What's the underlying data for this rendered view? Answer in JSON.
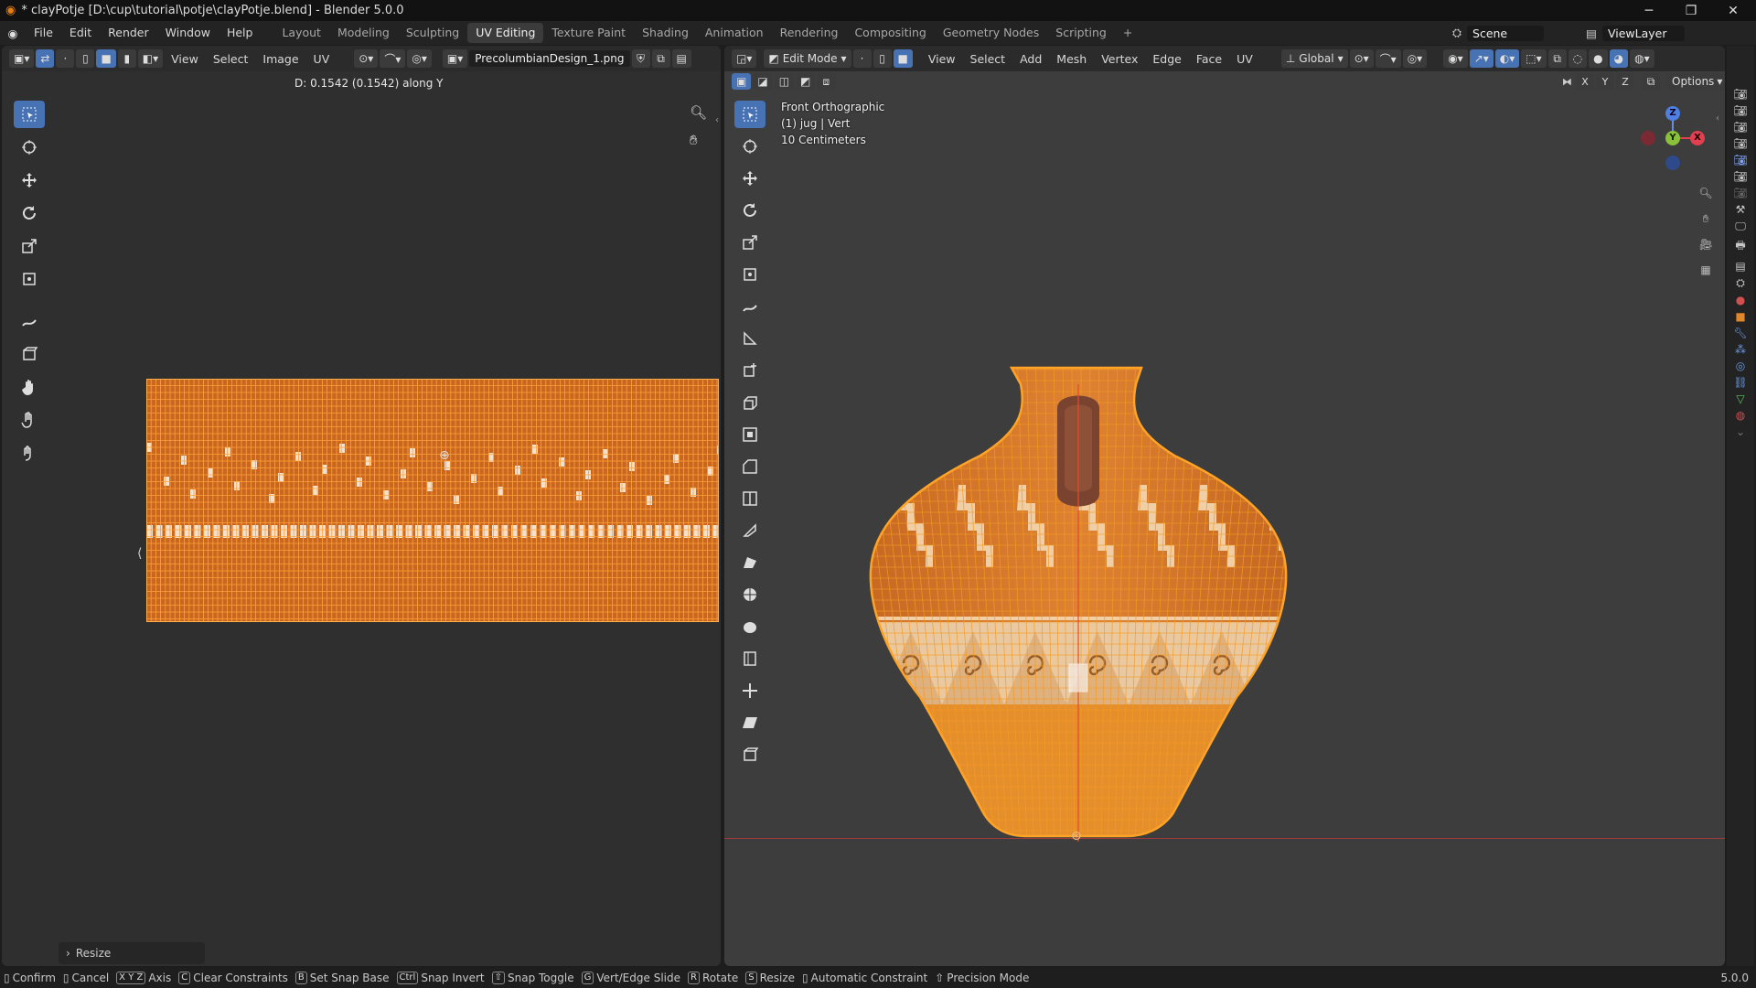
{
  "window": {
    "title": "* clayPotje [D:\\cup\\tutorial\\potje\\clayPotje.blend] - Blender 5.0.0",
    "minimize": "─",
    "restore": "❐",
    "close": "✕"
  },
  "menu": {
    "items": [
      "File",
      "Edit",
      "Render",
      "Window",
      "Help"
    ]
  },
  "workspaces": [
    "Layout",
    "Modeling",
    "Sculpting",
    "UV Editing",
    "Texture Paint",
    "Shading",
    "Animation",
    "Rendering",
    "Compositing",
    "Geometry Nodes",
    "Scripting"
  ],
  "workspace_active": "UV Editing",
  "workspace_add": "+",
  "scene": {
    "label": "Scene",
    "viewlayer": "ViewLayer"
  },
  "uv_editor": {
    "menus": [
      "View",
      "Select",
      "Image",
      "UV"
    ],
    "image_name": "PrecolumbianDesign_1.png",
    "operation_info": "D: 0.1542 (0.1542) along Y",
    "last_op_panel": "Resize"
  },
  "viewport": {
    "mode": "Edit Mode",
    "menus": [
      "View",
      "Select",
      "Add",
      "Mesh",
      "Vertex",
      "Edge",
      "Face",
      "UV"
    ],
    "transform_orientation": "Global",
    "options": "Options",
    "overlay_lines": [
      "Front Orthographic",
      "(1) jug | Vert",
      "10 Centimeters"
    ],
    "axes": {
      "x": "X",
      "y": "Y",
      "z": "Z"
    },
    "xyz": [
      "X",
      "Y",
      "Z"
    ]
  },
  "status": {
    "items": [
      {
        "key": "",
        "label": "Confirm"
      },
      {
        "key": "",
        "label": "Cancel"
      },
      {
        "key": "X Y Z",
        "label": "Axis"
      },
      {
        "key": "C",
        "label": "Clear Constraints"
      },
      {
        "key": "B",
        "label": "Set Snap Base"
      },
      {
        "key": "Ctrl",
        "label": "Snap Invert"
      },
      {
        "key": "⇧",
        "label": "Snap Toggle"
      },
      {
        "key": "G",
        "label": "Vert/Edge Slide"
      },
      {
        "key": "R",
        "label": "Rotate"
      },
      {
        "key": "S",
        "label": "Resize"
      },
      {
        "key": "",
        "label": "Automatic Constraint"
      },
      {
        "key": "",
        "label": "Precision Mode"
      }
    ],
    "version": "5.0.0"
  },
  "colors": {
    "accent": "#4772b3",
    "mesh_orange": "#e8891e",
    "clay": "#c8642c"
  }
}
